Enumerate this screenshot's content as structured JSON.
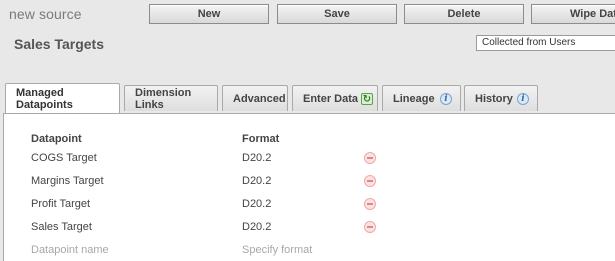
{
  "header": {
    "source_name": "new source",
    "title": "Sales Targets",
    "select_value": "Collected from Users"
  },
  "toolbar": {
    "new_label": "New",
    "save_label": "Save",
    "delete_label": "Delete",
    "wipe_label": "Wipe Data"
  },
  "tabs": [
    {
      "label": "Managed Datapoints",
      "active": true,
      "icon": null
    },
    {
      "label": "Dimension Links",
      "active": false,
      "icon": null
    },
    {
      "label": "Advanced",
      "active": false,
      "icon": null
    },
    {
      "label": "Enter Data",
      "active": false,
      "icon": "refresh-icon"
    },
    {
      "label": "Lineage",
      "active": false,
      "icon": "info-icon"
    },
    {
      "label": "History",
      "active": false,
      "icon": "info-icon"
    }
  ],
  "table": {
    "columns": [
      "Datapoint",
      "Format"
    ],
    "rows": [
      {
        "datapoint": "COGS Target",
        "format": "D20.2"
      },
      {
        "datapoint": "Margins Target",
        "format": "D20.2"
      },
      {
        "datapoint": "Profit Target",
        "format": "D20.2"
      },
      {
        "datapoint": "Sales Target",
        "format": "D20.2"
      }
    ],
    "new_row": {
      "datapoint_placeholder": "Datapoint name",
      "format_placeholder": "Specify format"
    }
  },
  "colors": {
    "background": "#e8e8e8",
    "panel": "#ffffff",
    "remove_icon": "#e08888",
    "info_icon": "#3a6ea5",
    "refresh_icon": "#2f7d1e"
  }
}
